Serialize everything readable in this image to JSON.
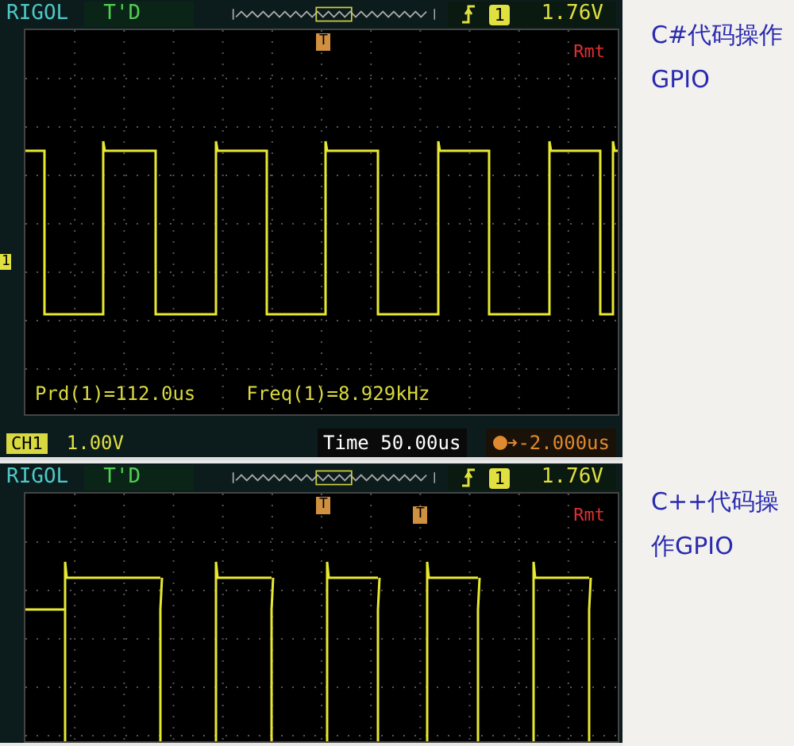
{
  "scopes": [
    {
      "header": {
        "brand": "RIGOL",
        "mode": "T'D",
        "channel": "1",
        "trigger_level": "1.76V"
      },
      "trigger_marker": "T",
      "remote": "Rmt",
      "channel_marker": "1",
      "measurements": [
        "Prd(1)=112.0us",
        "Freq(1)=8.929kHz"
      ],
      "footer": {
        "channel": "CH1",
        "volts": "1.00V",
        "timebase": "Time 50.00us",
        "offset": "-2.000us"
      }
    },
    {
      "header": {
        "brand": "RIGOL",
        "mode": "T'D",
        "channel": "1",
        "trigger_level": "1.76V"
      },
      "trigger_marker": "T",
      "position_marker": "T",
      "remote": "Rmt"
    }
  ],
  "captions": [
    {
      "lines": [
        "C#代码操作",
        "GPIO"
      ]
    },
    {
      "lines": [
        "C++代码操",
        "作GPIO"
      ]
    }
  ]
}
